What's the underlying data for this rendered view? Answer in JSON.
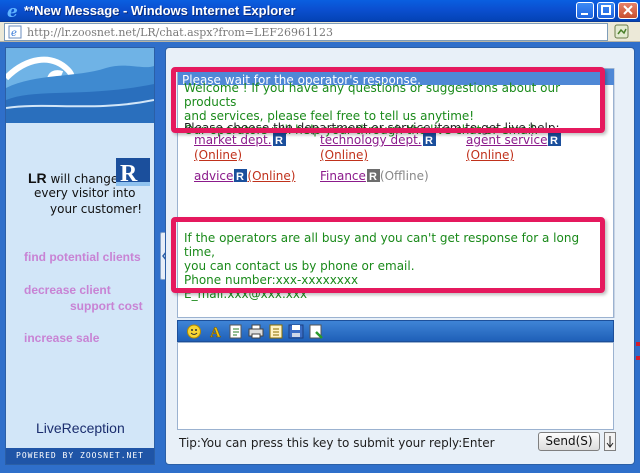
{
  "window": {
    "title": "**New Message - Windows Internet Explorer",
    "address": "http://lr.zoosnet.net/LR/chat.aspx?from=LEF26961123"
  },
  "left_panel": {
    "tagline_1_bold": "LR",
    "tagline_1_rest": " will change",
    "tagline_2": "every visitor into",
    "tagline_3": "your customer!",
    "promo_1": "find potential clients",
    "promo_2a": "decrease client",
    "promo_2b": "support cost",
    "promo_3": "increase sale",
    "brand": "LiveReception",
    "powered_by": "POWERED BY ZOOSNET.NET"
  },
  "chat": {
    "wait_text": "Please wait for the operator's response.",
    "welcome_lines": [
      "Welcome ! If you have any questions or suggestions about our products",
      "and services, please feel free to tell us anytime!",
      "Our operators will help your through the live chat or email."
    ],
    "choose_text": "Please choose the department or service item to get live help:",
    "departments": [
      {
        "name": "market dept.",
        "status": "(Online)"
      },
      {
        "name": "technology dept.",
        "status": "(Online)"
      },
      {
        "name": "agent service",
        "status": "(Online)"
      },
      {
        "name": "advice",
        "status": "(Online)"
      },
      {
        "name": "Finance",
        "status": "(Offline)"
      }
    ],
    "busy_lines": [
      "If the operators are all busy and you can't get response for a long time,",
      "you can contact us by phone or email.",
      "Phone number:xxx-xxxxxxxx",
      "E_mail:xxx@xxx.xxx"
    ]
  },
  "footer": {
    "tip": "Tip:You can press this key to submit your reply:Enter",
    "send_label": "Send(S)"
  },
  "icons": {
    "browser": "ie-icon",
    "toolbar": [
      "emoticon-icon",
      "font-icon",
      "file-icon",
      "print-icon",
      "history-icon",
      "save-icon",
      "settings-icon"
    ]
  },
  "colors": {
    "highlight_border": "#e5195e",
    "green_text": "#1a8a1a",
    "link_purple": "#8b1a8b",
    "status_red": "#c0311b",
    "frame_blue": "#2f6fca"
  }
}
